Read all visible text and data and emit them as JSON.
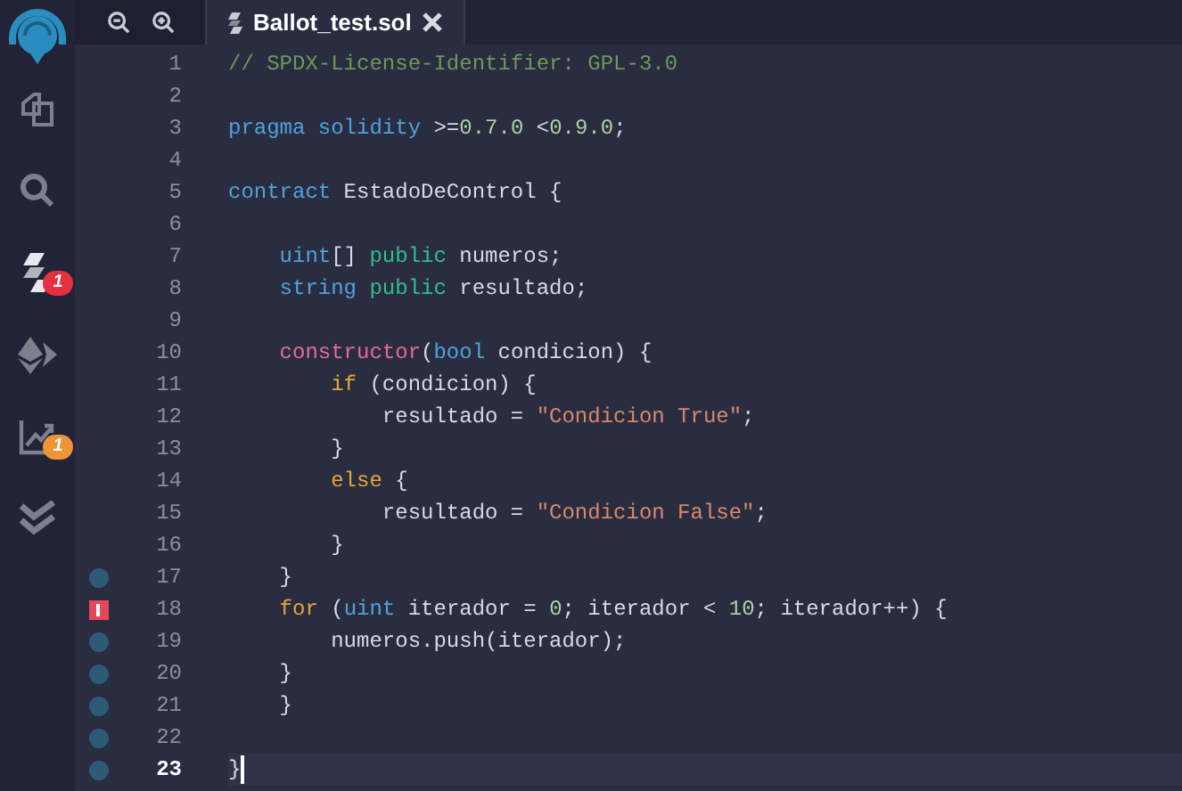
{
  "sidebar": {
    "items": [
      {
        "kind": "files",
        "selected": false
      },
      {
        "kind": "search",
        "selected": false
      },
      {
        "kind": "compiler",
        "selected": false,
        "badge": {
          "text": "1",
          "color": "#e5303f"
        }
      },
      {
        "kind": "deploy",
        "selected": false
      },
      {
        "kind": "analysis",
        "selected": false,
        "badge": {
          "text": "1",
          "color": "#f0943a"
        }
      },
      {
        "kind": "tests",
        "selected": false
      }
    ]
  },
  "tabs": [
    {
      "label": "Ballot_test.sol",
      "selected": true
    }
  ],
  "editor": {
    "lines": [
      {
        "number": "1",
        "breakpoint": false,
        "error": false,
        "active": false,
        "tokens": [
          {
            "kind": "comment",
            "t": "// SPDX-License-Identifier: GPL-3.0"
          }
        ]
      },
      {
        "number": "2",
        "breakpoint": false,
        "error": false,
        "active": false
      },
      {
        "number": "3",
        "breakpoint": false,
        "error": false,
        "active": false,
        "tokens": [
          {
            "kind": "keyword",
            "t": "pragma solidity"
          },
          {
            "kind": "plain",
            "t": " >="
          },
          {
            "kind": "number",
            "t": "0.7.0"
          },
          {
            "kind": "plain",
            "t": " <"
          },
          {
            "kind": "number",
            "t": "0.9.0"
          },
          {
            "kind": "plain",
            "t": ";"
          }
        ]
      },
      {
        "number": "4",
        "breakpoint": false,
        "error": false,
        "active": false
      },
      {
        "number": "5",
        "breakpoint": false,
        "error": false,
        "active": false,
        "tokens": [
          {
            "kind": "keyword",
            "t": "contract"
          },
          {
            "kind": "plain",
            "t": " EstadoDeControl {"
          }
        ]
      },
      {
        "number": "6",
        "breakpoint": false,
        "error": false,
        "active": false
      },
      {
        "number": "7",
        "breakpoint": false,
        "error": false,
        "active": false,
        "tokens": [
          {
            "kind": "keyword",
            "t": "    uint"
          },
          {
            "kind": "plain",
            "t": "[] "
          },
          {
            "kind": "modifier",
            "t": "public"
          },
          {
            "kind": "plain",
            "t": " numeros;"
          }
        ]
      },
      {
        "number": "8",
        "breakpoint": false,
        "error": false,
        "active": false,
        "tokens": [
          {
            "kind": "keyword",
            "t": "    string"
          },
          {
            "kind": "modifier",
            "t": " public"
          },
          {
            "kind": "plain",
            "t": " resultado;"
          }
        ]
      },
      {
        "number": "9",
        "breakpoint": false,
        "error": false,
        "active": false
      },
      {
        "number": "10",
        "breakpoint": false,
        "error": false,
        "active": false,
        "tokens": [
          {
            "kind": "special",
            "t": "    constructor"
          },
          {
            "kind": "plain",
            "t": "("
          },
          {
            "kind": "keyword",
            "t": "bool"
          },
          {
            "kind": "plain",
            "t": " condicion) {"
          }
        ]
      },
      {
        "number": "11",
        "breakpoint": false,
        "error": false,
        "active": false,
        "tokens": [
          {
            "kind": "control",
            "t": "        if"
          },
          {
            "kind": "plain",
            "t": " (condicion) {"
          }
        ]
      },
      {
        "number": "12",
        "breakpoint": false,
        "error": false,
        "active": false,
        "tokens": [
          {
            "kind": "plain",
            "t": "            resultado = "
          },
          {
            "kind": "string",
            "t": "\"Condicion True\""
          },
          {
            "kind": "plain",
            "t": ";"
          }
        ]
      },
      {
        "number": "13",
        "breakpoint": false,
        "error": false,
        "active": false,
        "tokens": [
          {
            "kind": "plain",
            "t": "        }"
          }
        ]
      },
      {
        "number": "14",
        "breakpoint": false,
        "error": false,
        "active": false,
        "tokens": [
          {
            "kind": "control",
            "t": "        else"
          },
          {
            "kind": "plain",
            "t": " {"
          }
        ]
      },
      {
        "number": "15",
        "breakpoint": false,
        "error": false,
        "active": false,
        "tokens": [
          {
            "kind": "plain",
            "t": "            resultado = "
          },
          {
            "kind": "string",
            "t": "\"Condicion False\""
          },
          {
            "kind": "plain",
            "t": ";"
          }
        ]
      },
      {
        "number": "16",
        "breakpoint": false,
        "error": false,
        "active": false,
        "tokens": [
          {
            "kind": "plain",
            "t": "        }"
          }
        ]
      },
      {
        "number": "17",
        "breakpoint": true,
        "error": false,
        "active": false,
        "tokens": [
          {
            "kind": "plain",
            "t": "    }"
          }
        ]
      },
      {
        "number": "18",
        "breakpoint": false,
        "error": true,
        "active": false,
        "tokens": [
          {
            "kind": "control",
            "t": "    for"
          },
          {
            "kind": "plain",
            "t": " ("
          },
          {
            "kind": "keyword",
            "t": "uint"
          },
          {
            "kind": "plain",
            "t": " iterador = "
          },
          {
            "kind": "number",
            "t": "0"
          },
          {
            "kind": "plain",
            "t": "; iterador < "
          },
          {
            "kind": "number",
            "t": "10"
          },
          {
            "kind": "plain",
            "t": "; iterador++) {"
          }
        ]
      },
      {
        "number": "19",
        "breakpoint": true,
        "error": false,
        "active": false,
        "tokens": [
          {
            "kind": "plain",
            "t": "        numeros.push(iterador);"
          }
        ]
      },
      {
        "number": "20",
        "breakpoint": true,
        "error": false,
        "active": false,
        "tokens": [
          {
            "kind": "plain",
            "t": "    }"
          }
        ]
      },
      {
        "number": "21",
        "breakpoint": true,
        "error": false,
        "active": false,
        "tokens": [
          {
            "kind": "plain",
            "t": "    }"
          }
        ]
      },
      {
        "number": "22",
        "breakpoint": true,
        "error": false,
        "active": false
      },
      {
        "number": "23",
        "breakpoint": true,
        "error": false,
        "active": true,
        "tokens": [
          {
            "kind": "plain",
            "t": "}"
          }
        ]
      }
    ]
  }
}
